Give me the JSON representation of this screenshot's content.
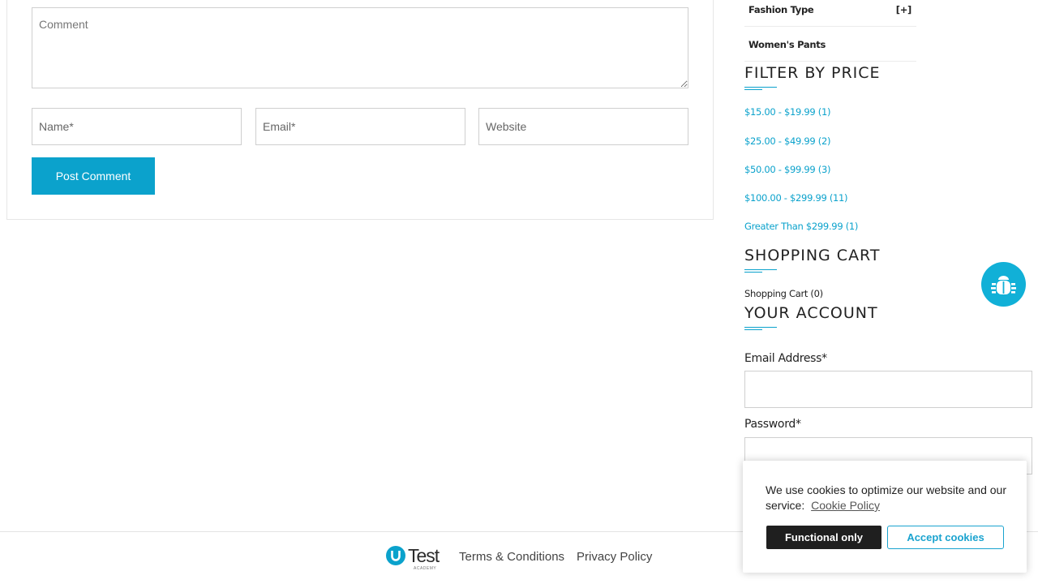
{
  "comment_form": {
    "comment_placeholder": "Comment",
    "name_placeholder": "Name*",
    "email_placeholder": "Email*",
    "website_placeholder": "Website",
    "submit_label": "Post Comment"
  },
  "sidebar": {
    "categories": [
      {
        "label": "Fashion Type",
        "toggle": "[+]"
      },
      {
        "label": "Women's Pants",
        "toggle": ""
      }
    ],
    "filter_by_price": {
      "title": "FILTER BY PRICE",
      "ranges": [
        "$15.00 - $19.99 (1)",
        "$25.00 - $49.99 (2)",
        "$50.00 - $99.99 (3)",
        "$100.00 - $299.99 (11)",
        "Greater Than $299.99 (1)"
      ]
    },
    "shopping_cart": {
      "title": "SHOPPING CART",
      "link": "Shopping Cart (0)"
    },
    "your_account": {
      "title": "YOUR ACCOUNT",
      "email_label": "Email Address*",
      "password_label": "Password*"
    }
  },
  "bug_report": {
    "icon": "bug-icon",
    "color": "#11b0d7"
  },
  "footer": {
    "logo_text": "Test",
    "logo_sub": "ACADEMY",
    "links": [
      "Terms & Conditions",
      "Privacy Policy"
    ]
  },
  "cookie_banner": {
    "text": "We use cookies to optimize our website and our service:",
    "policy_link": "Cookie Policy",
    "functional_label": "Functional only",
    "accept_label": "Accept cookies"
  },
  "colors": {
    "accent": "#0ba2cc",
    "dark_button": "#1f1f1f"
  }
}
